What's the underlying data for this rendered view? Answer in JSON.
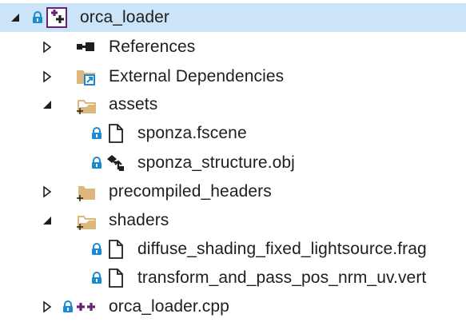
{
  "solution_explorer": {
    "project": {
      "name": "orca_loader",
      "expanded": true,
      "selected": true,
      "icon": "cpp-project-icon",
      "locked": true
    },
    "nodes": [
      {
        "label": "References",
        "icon": "references-icon",
        "expanded": false
      },
      {
        "label": "External Dependencies",
        "icon": "external-dependencies-icon",
        "expanded": false
      },
      {
        "label": "assets",
        "icon": "filter-folder-icon",
        "expanded": true
      },
      {
        "label": "sponza.fscene",
        "icon": "file-icon",
        "locked": true
      },
      {
        "label": "sponza_structure.obj",
        "icon": "obj-file-icon",
        "locked": true
      },
      {
        "label": "precompiled_headers",
        "icon": "filter-folder-icon",
        "expanded": false
      },
      {
        "label": "shaders",
        "icon": "filter-folder-icon",
        "expanded": true
      },
      {
        "label": "diffuse_shading_fixed_lightsource.frag",
        "icon": "file-icon",
        "locked": true
      },
      {
        "label": "transform_and_pass_pos_nrm_uv.vert",
        "icon": "file-icon",
        "locked": true
      },
      {
        "label": "orca_loader.cpp",
        "icon": "cpp-file-icon",
        "locked": true,
        "expanded": false
      }
    ],
    "colors": {
      "selection": "#cce4f7",
      "lock": "#1a8ad4",
      "folder": "#dcb67a",
      "cpp": "#68217a",
      "text": "#1e1e1e"
    }
  }
}
